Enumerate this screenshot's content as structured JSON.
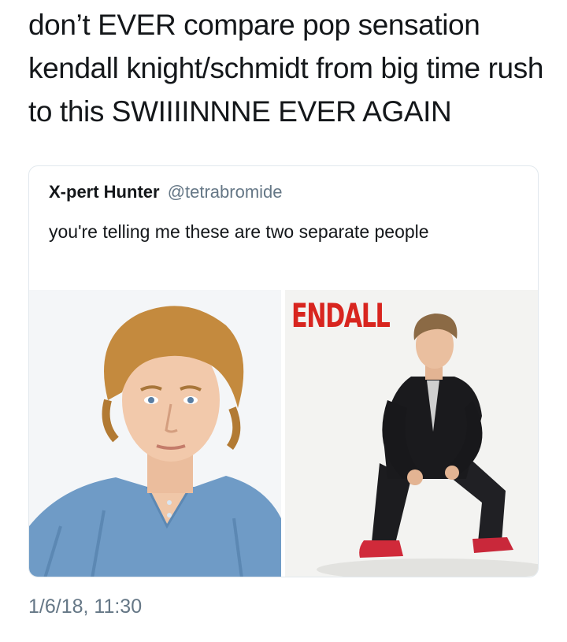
{
  "tweet": {
    "text": "don’t EVER compare pop sensation kendall knight/schmidt from big time rush to this SWIIIINNNE EVER AGAIN",
    "timestamp": "1/6/18, 11:30"
  },
  "quoted_tweet": {
    "author_name": "X-pert Hunter",
    "author_handle": "@tetrabromide",
    "text": "you're telling me these are two separate people",
    "media": {
      "left_image_alt": "young man with wavy blonde hair in a blue henley shirt",
      "right_image_overlay_text": "ENDALL",
      "right_image_alt": "young man in black jacket crouching in red sneakers"
    }
  },
  "colors": {
    "text_primary": "#14171a",
    "text_secondary": "#657786",
    "card_border": "#e1e8ed",
    "overlay_red": "#d8251f"
  }
}
